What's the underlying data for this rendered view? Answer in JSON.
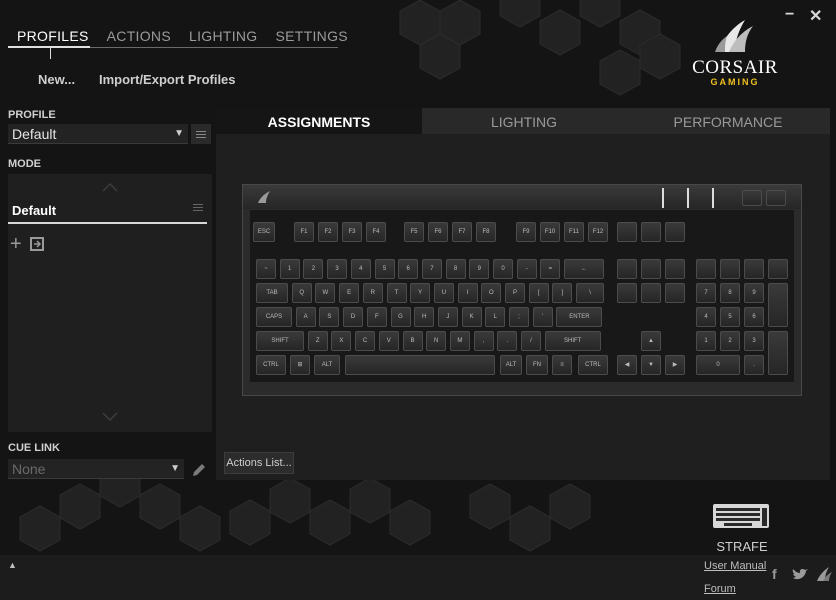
{
  "nav": {
    "tabs": [
      "PROFILES",
      "ACTIONS",
      "LIGHTING",
      "SETTINGS"
    ],
    "sub": {
      "new": "New...",
      "import_export": "Import/Export Profiles"
    }
  },
  "window": {
    "minimize": "−",
    "close": "✕"
  },
  "logo": {
    "brand": "CORSAIR",
    "sub": "GAMING"
  },
  "sidebar": {
    "profile_label": "PROFILE",
    "profile_value": "Default",
    "mode_label": "MODE",
    "mode_item": "Default",
    "cue_link_label": "CUE LINK",
    "cue_link_value": "None"
  },
  "panel": {
    "tabs": [
      "ASSIGNMENTS",
      "LIGHTING",
      "PERFORMANCE"
    ],
    "actions_list": "Actions List..."
  },
  "keyboard": {
    "rows": {
      "fn": [
        "ESC",
        "F1",
        "F2",
        "F3",
        "F4",
        "F5",
        "F6",
        "F7",
        "F8",
        "F9",
        "F10",
        "F11",
        "F12"
      ],
      "num": [
        "~",
        "1",
        "2",
        "3",
        "4",
        "5",
        "6",
        "7",
        "8",
        "9",
        "0",
        "-",
        "=",
        "←"
      ],
      "top": [
        "TAB",
        "Q",
        "W",
        "E",
        "R",
        "T",
        "Y",
        "U",
        "I",
        "O",
        "P",
        "[",
        "]",
        "\\"
      ],
      "home": [
        "CAPS LOCK",
        "A",
        "S",
        "D",
        "F",
        "G",
        "H",
        "J",
        "K",
        "L",
        ";",
        "'",
        "ENTER"
      ],
      "bottom": [
        "SHIFT",
        "Z",
        "X",
        "C",
        "V",
        "B",
        "N",
        "M",
        ",",
        ".",
        "/",
        "SHIFT"
      ],
      "space": [
        "CTRL",
        "⊞",
        "ALT",
        "",
        "ALT",
        "FN",
        "≡",
        "CTRL"
      ],
      "numpad": [
        "7",
        "8",
        "9",
        "4",
        "5",
        "6",
        "1",
        "2",
        "3",
        "0",
        "."
      ]
    }
  },
  "device": {
    "name": "STRAFE"
  },
  "footer": {
    "user_manual": "User Manual",
    "forum": "Forum",
    "expand_icon": "▲"
  },
  "colors": {
    "accent": "#f0c020",
    "bg": "#141414",
    "panel": "#1f1f1f"
  }
}
